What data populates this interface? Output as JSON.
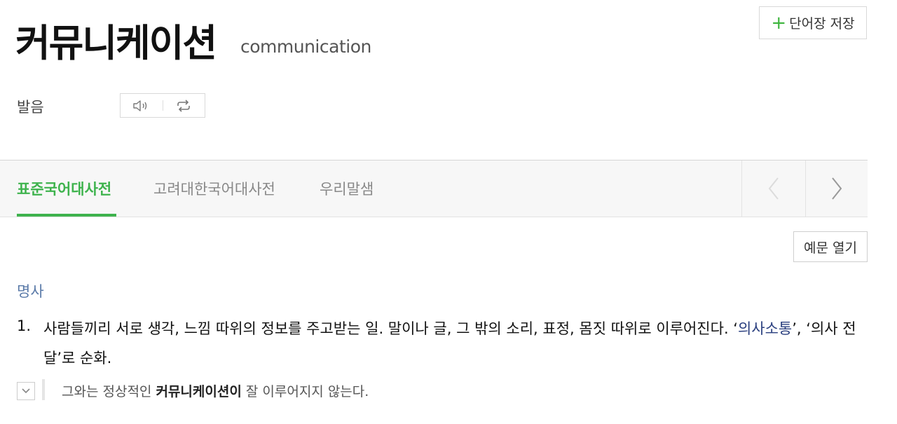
{
  "entry": {
    "headword": "커뮤니케이션",
    "origin": "communication",
    "save_button": "단어장 저장",
    "pronunciation_label": "발음",
    "icons": [
      "speaker-icon",
      "repeat-icon"
    ]
  },
  "tabs": [
    {
      "label": "표준국어대사전",
      "active": true
    },
    {
      "label": "고려대한국어대사전",
      "active": false
    },
    {
      "label": "우리말샘",
      "active": false
    }
  ],
  "examples_button": "예문 열기",
  "definition": {
    "pos": "명사",
    "number": "1.",
    "text_before": "사람들끼리 서로 생각, 느낌 따위의 정보를 주고받는 일. 말이나 글, 그 밖의 소리, 표정, 몸짓 따위로 이루어진다. ‘",
    "link1": "의사소통",
    "text_middle": "’, ‘의사 전달’로 순화.",
    "example_before": "그와는 정상적인 ",
    "example_bold": "커뮤니케이션이",
    "example_after": " 잘 이루어지지 않는다."
  },
  "colors": {
    "accent_green": "#3eb34d",
    "pos_blue": "#5a7aa8",
    "link_navy": "#2a3f7f"
  }
}
